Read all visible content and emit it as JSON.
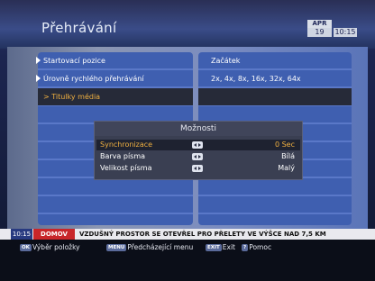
{
  "header": {
    "title": "Přehrávání",
    "date_month": "APR",
    "date_day": "19",
    "time": "10:15"
  },
  "left_menu": {
    "items": [
      {
        "label": "Startovací pozice"
      },
      {
        "label": "Úrovně rychlého přehrávání"
      },
      {
        "label": "Titulky média",
        "selected": true
      }
    ]
  },
  "right_menu": {
    "values": [
      "Začátek",
      "2x, 4x, 8x, 16x, 32x, 64x"
    ]
  },
  "options_popup": {
    "title": "Možnosti",
    "rows": [
      {
        "label": "Synchronizace",
        "value": "0 Sec",
        "selected": true
      },
      {
        "label": "Barva písma",
        "value": "Bílá"
      },
      {
        "label": "Velikost písma",
        "value": "Malý"
      }
    ]
  },
  "ticker": {
    "time": "10:15",
    "tag": "DOMOV",
    "text": "VZDUŠNÝ PROSTOR SE OTEVŘEL PRO PŘELETY VE VÝŠCE NAD 7,5 KM"
  },
  "footer": {
    "ok_key": "OK",
    "ok_label": "Výběr položky",
    "menu_key": "MENU",
    "menu_label": "Předcházející menu",
    "exit_key": "EXIT",
    "exit_label": "Exit",
    "help_key": "?",
    "help_label": "Pomoc"
  },
  "colors": {
    "accent_selected": "#f0b040",
    "panel_blue": "#3f5fb0",
    "ticker_tag": "#c8262a"
  }
}
